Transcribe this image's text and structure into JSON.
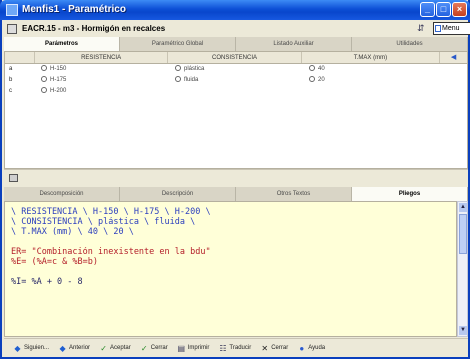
{
  "window": {
    "title": "Menfis1 - Paramétrico",
    "minimize_label": "_",
    "maximize_label": "□",
    "close_label": "×"
  },
  "header": {
    "title": "EACR.15 - m3 - Hormigón en recalces",
    "menu_label": "Menu"
  },
  "top_tabs": [
    {
      "label": "Parámetros",
      "active": true
    },
    {
      "label": "Paramétrico Global",
      "active": false
    },
    {
      "label": "Listado Auxiliar",
      "active": false
    },
    {
      "label": "Utilidades",
      "active": false
    }
  ],
  "grid": {
    "columns": [
      "RESISTENCIA",
      "CONSISTENCIA",
      "T.MAX (mm)"
    ],
    "scroll_glyph": "◀",
    "rows": [
      {
        "label": "a",
        "cells": [
          "H-150",
          "plástica",
          "40"
        ]
      },
      {
        "label": "b",
        "cells": [
          "H-175",
          "fluida",
          "20"
        ]
      },
      {
        "label": "c",
        "cells": [
          "H-200",
          "",
          ""
        ]
      }
    ]
  },
  "bottom_tabs": [
    {
      "label": "Descomposición",
      "active": false
    },
    {
      "label": "Descripción",
      "active": false
    },
    {
      "label": "Otros Textos",
      "active": false
    },
    {
      "label": "Pliegos",
      "active": true
    }
  ],
  "editor": {
    "lines": [
      {
        "text": "\\ RESISTENCIA \\ H-150 \\ H-175 \\ H-200 \\",
        "color": "blue"
      },
      {
        "text": "\\ CONSISTENCIA \\ plástica \\ fluida \\",
        "color": "blue"
      },
      {
        "text": "\\ T.MAX (mm) \\ 40 \\ 20 \\",
        "color": "blue"
      },
      {
        "text": "",
        "color": "blue"
      },
      {
        "text": "ER= \"Combinación inexistente en la bdu\"",
        "color": "red"
      },
      {
        "text": "%E= (%A=c & %B=b)",
        "color": "red"
      },
      {
        "text": "",
        "color": "blue"
      },
      {
        "text": "%I= %A + 0 - 8",
        "color": "dark"
      }
    ]
  },
  "toolbar": {
    "items": [
      {
        "icon": "◆",
        "label": "Siguien..."
      },
      {
        "icon": "◆",
        "label": "Anterior"
      },
      {
        "icon": "✓",
        "label": "Aceptar"
      },
      {
        "icon": "✓",
        "label": "Cerrar"
      },
      {
        "icon": "▤",
        "label": "Imprimir"
      },
      {
        "icon": "☷",
        "label": "Traducir"
      },
      {
        "icon": "✕",
        "label": "Cerrar"
      },
      {
        "icon": "●",
        "label": "Ayuda"
      }
    ]
  }
}
